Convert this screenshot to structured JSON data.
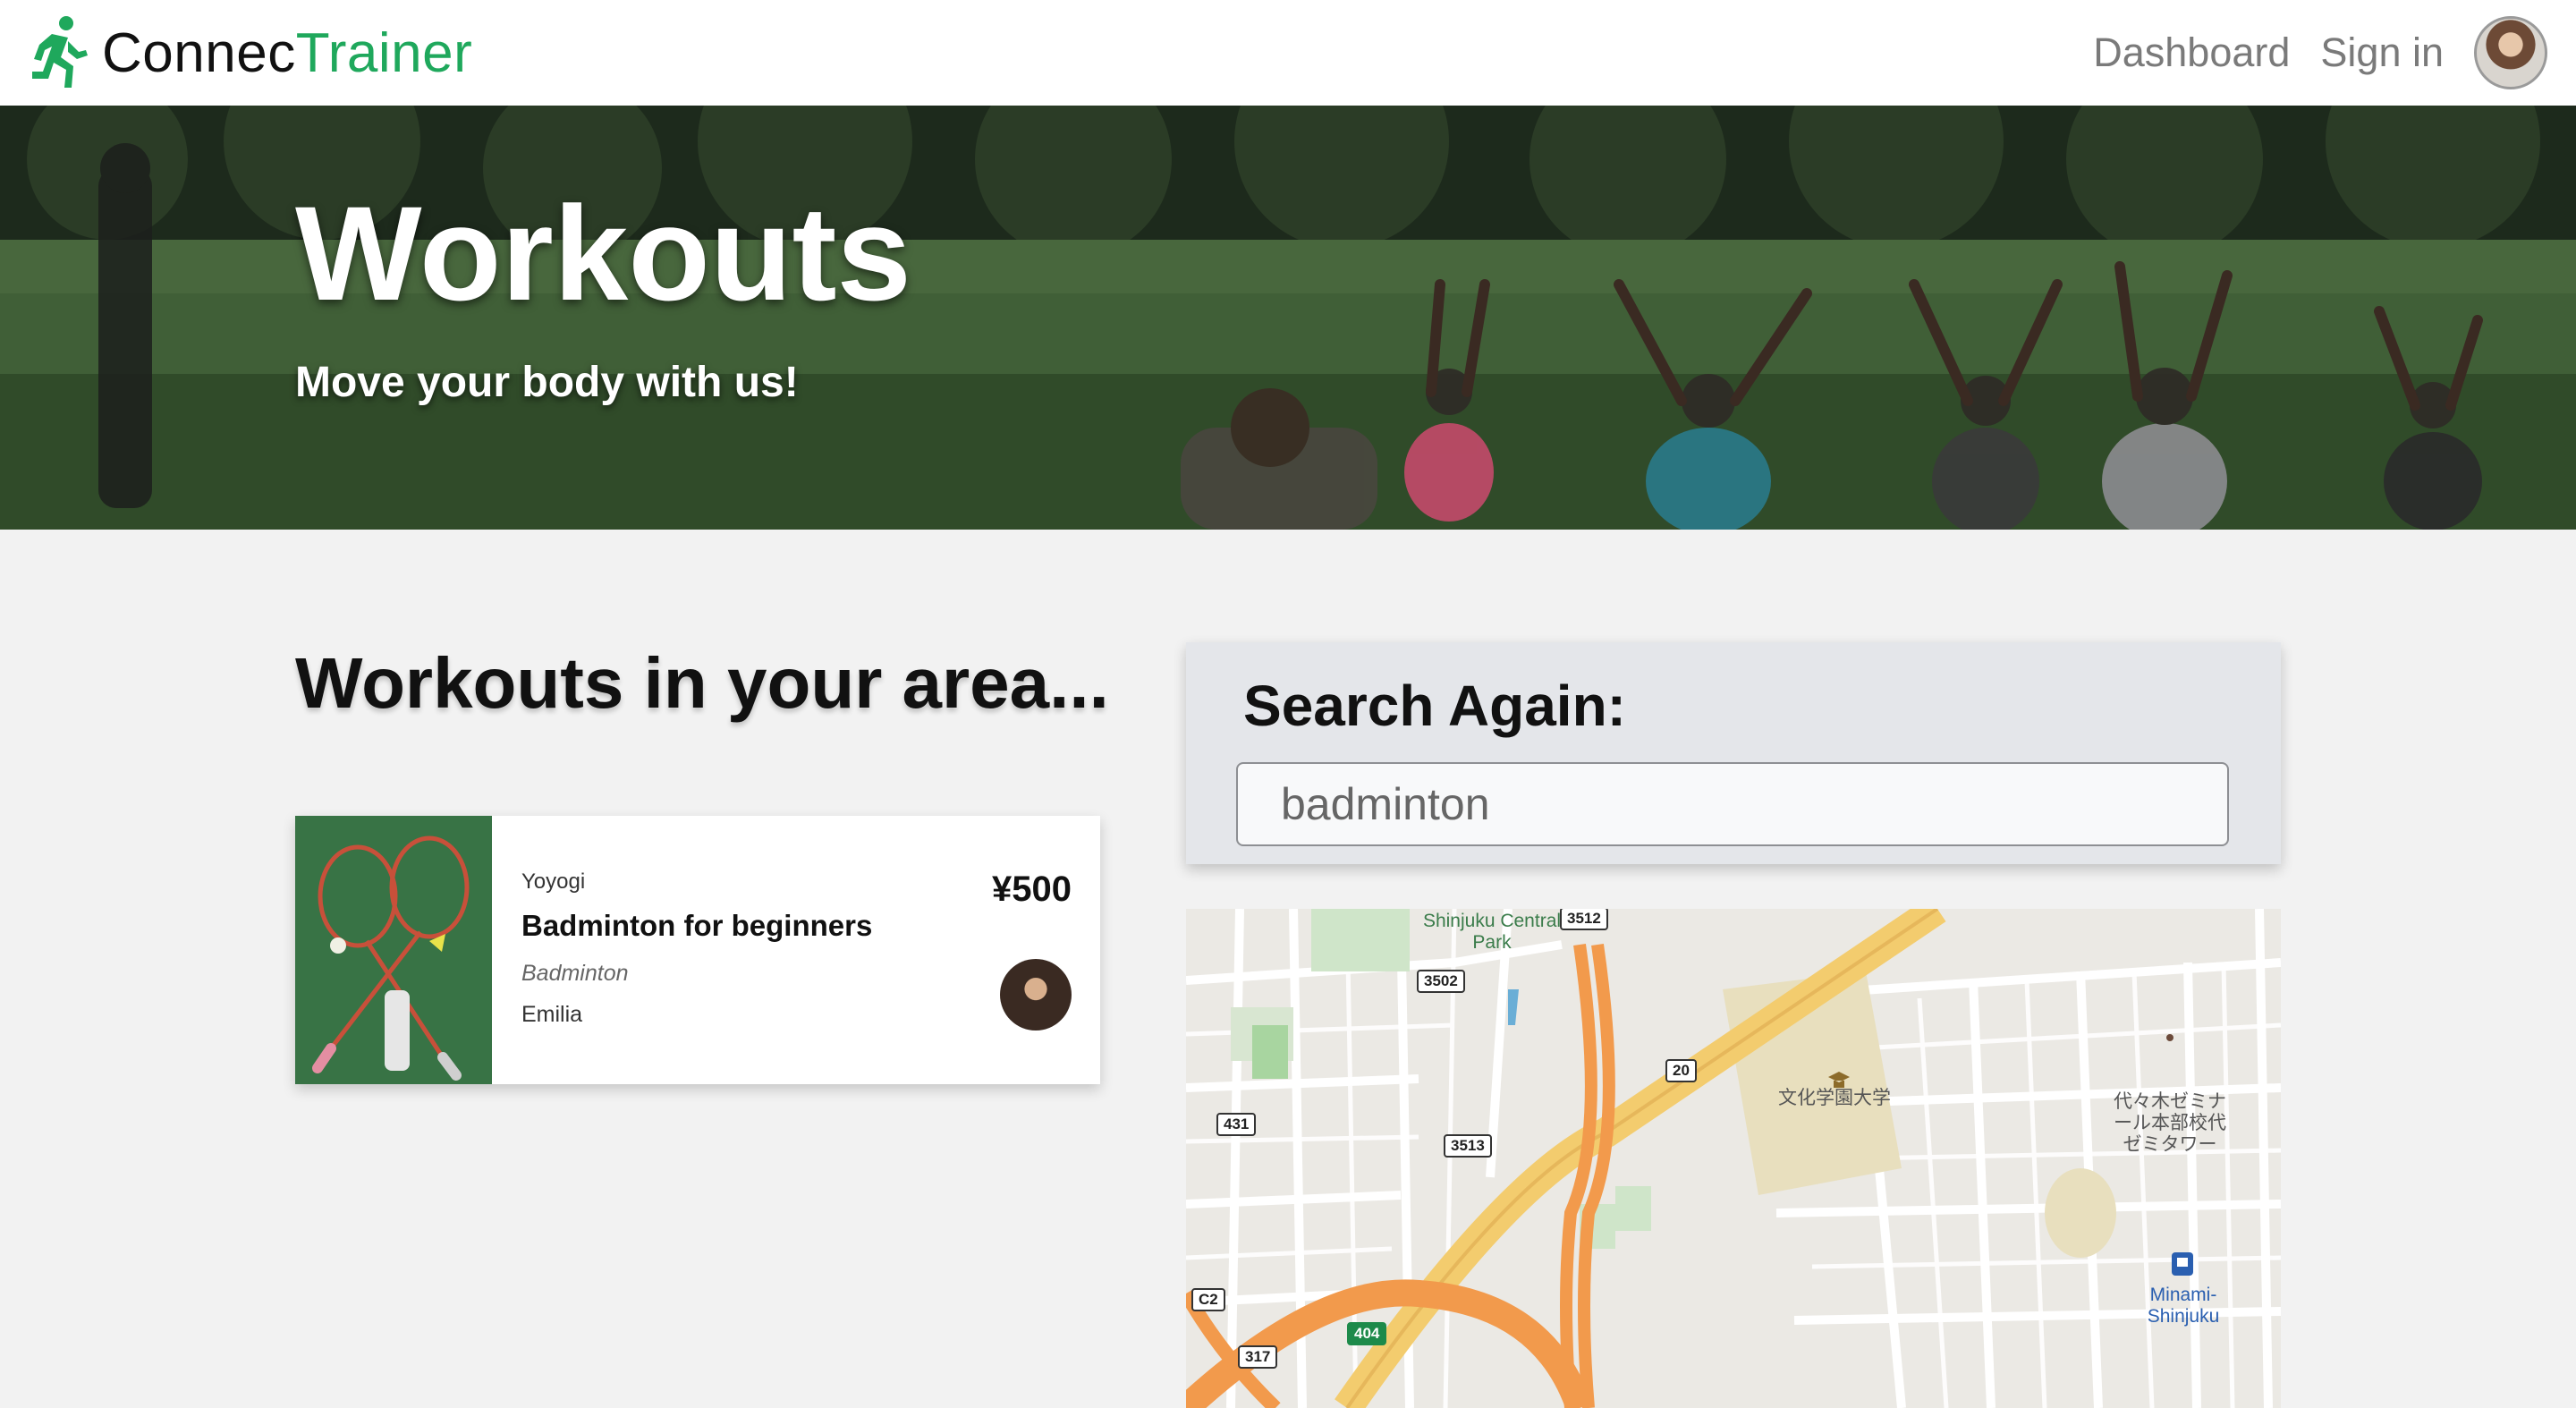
{
  "brand": {
    "name_part1": "Connec",
    "name_part2": "Trainer",
    "accent_color": "#1fa85c"
  },
  "nav": {
    "dashboard": "Dashboard",
    "sign_in": "Sign in"
  },
  "hero": {
    "title": "Workouts",
    "subtitle": "Move your body with us!"
  },
  "results": {
    "heading": "Workouts in your area...",
    "cards": [
      {
        "location": "Yoyogi",
        "title": "Badminton for beginners",
        "sport": "Badminton",
        "trainer": "Emilia",
        "price": "¥500"
      }
    ]
  },
  "search": {
    "heading": "Search Again:",
    "value": "badminton"
  },
  "map": {
    "labels": {
      "park": "Shinjuku Central Park",
      "university": "文化学園大学",
      "school": "代々木ゼミナール本部校代ゼミタワー",
      "station": "Minami-Shinjuku"
    },
    "route_shields": [
      "3512",
      "3502",
      "20",
      "431",
      "3513",
      "C2",
      "404",
      "317"
    ]
  }
}
